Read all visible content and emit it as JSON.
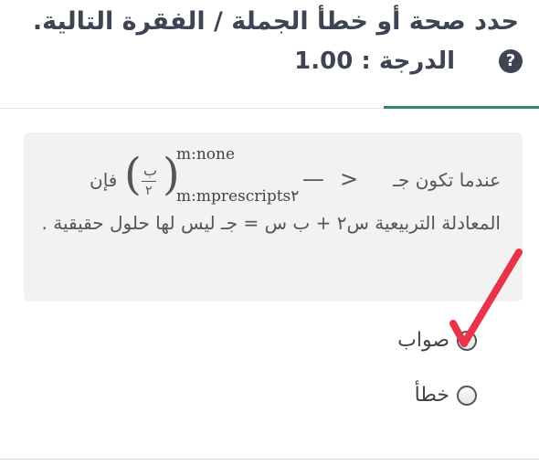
{
  "header": {
    "title": "حدد صحة أو خطأ الجملة / الفقرة التالية.",
    "grade": "الدرجة : 1.00",
    "help_icon": "question-circle-icon"
  },
  "question": {
    "line1_text": "عندما تكون جـ",
    "operator_gt": ">",
    "operator_minus": "—",
    "m_none": "m:none",
    "m_prescripts": "m:mprescripts٢",
    "fraction_numerator": "ب",
    "fraction_denominator": "٢",
    "then_word": "فإن",
    "line2_text": "المعادلة التربيعية س٢ + ب س = جـ ليس لها حلول حقيقية ."
  },
  "options": [
    {
      "label": "صواب",
      "checked": false
    },
    {
      "label": "خطأ",
      "checked": false
    }
  ],
  "annotation": {
    "mark": "red-checkmark",
    "color": "#e8344a"
  }
}
